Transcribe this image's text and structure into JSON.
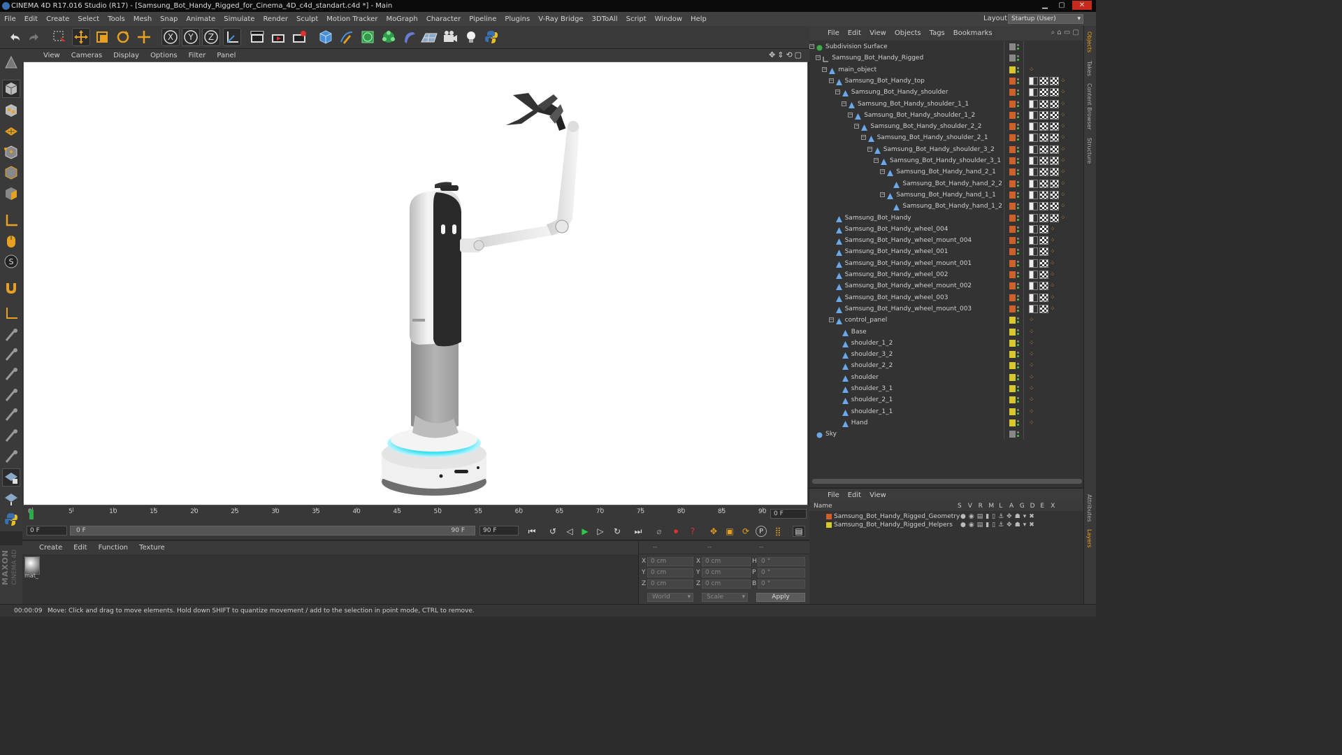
{
  "window": {
    "title": "CINEMA 4D R17.016 Studio (R17) - [Samsung_Bot_Handy_Rigged_for_Cinema_4D_c4d_standart.c4d *] - Main"
  },
  "menubar": [
    "File",
    "Edit",
    "Create",
    "Select",
    "Tools",
    "Mesh",
    "Snap",
    "Animate",
    "Simulate",
    "Render",
    "Sculpt",
    "Motion Tracker",
    "MoGraph",
    "Character",
    "Pipeline",
    "Plugins",
    "V-Ray Bridge",
    "3DToAll",
    "Script",
    "Window",
    "Help"
  ],
  "layout": {
    "label": "Layout:",
    "value": "Startup (User)"
  },
  "viewport_menu": [
    "View",
    "Cameras",
    "Display",
    "Options",
    "Filter",
    "Panel"
  ],
  "object_manager": {
    "menu": [
      "File",
      "Edit",
      "View",
      "Objects",
      "Tags",
      "Bookmarks"
    ],
    "items": [
      {
        "name": "Subdivision Surface",
        "depth": 0,
        "icon": "subdivision-icon",
        "color": "#888888"
      },
      {
        "name": "Samsung_Bot_Handy_Rigged",
        "depth": 1,
        "icon": "null-icon",
        "color": "#888888"
      },
      {
        "name": "main_object",
        "depth": 2,
        "icon": "joint-icon",
        "color": "#d8c82a"
      },
      {
        "name": "Samsung_Bot_Handy_top",
        "depth": 3,
        "icon": "joint-icon",
        "color": "#d0602a"
      },
      {
        "name": "Samsung_Bot_Handy_shoulder",
        "depth": 4,
        "icon": "joint-icon",
        "color": "#d0602a"
      },
      {
        "name": "Samsung_Bot_Handy_shoulder_1_1",
        "depth": 5,
        "icon": "joint-icon",
        "color": "#d0602a"
      },
      {
        "name": "Samsung_Bot_Handy_shoulder_1_2",
        "depth": 6,
        "icon": "joint-icon",
        "color": "#d0602a"
      },
      {
        "name": "Samsung_Bot_Handy_shoulder_2_2",
        "depth": 7,
        "icon": "joint-icon",
        "color": "#d0602a"
      },
      {
        "name": "Samsung_Bot_Handy_shoulder_2_1",
        "depth": 8,
        "icon": "joint-icon",
        "color": "#d0602a"
      },
      {
        "name": "Samsung_Bot_Handy_shoulder_3_2",
        "depth": 9,
        "icon": "joint-icon",
        "color": "#d0602a"
      },
      {
        "name": "Samsung_Bot_Handy_shoulder_3_1",
        "depth": 10,
        "icon": "joint-icon",
        "color": "#d0602a"
      },
      {
        "name": "Samsung_Bot_Handy_hand_2_1",
        "depth": 11,
        "icon": "joint-icon",
        "color": "#d0602a"
      },
      {
        "name": "Samsung_Bot_Handy_hand_2_2",
        "depth": 12,
        "icon": "joint-icon",
        "color": "#d0602a"
      },
      {
        "name": "Samsung_Bot_Handy_hand_1_1",
        "depth": 11,
        "icon": "joint-icon",
        "color": "#d0602a"
      },
      {
        "name": "Samsung_Bot_Handy_hand_1_2",
        "depth": 12,
        "icon": "joint-icon",
        "color": "#d0602a"
      },
      {
        "name": "Samsung_Bot_Handy",
        "depth": 3,
        "icon": "joint-icon",
        "color": "#d0602a"
      },
      {
        "name": "Samsung_Bot_Handy_wheel_004",
        "depth": 3,
        "icon": "joint-icon",
        "color": "#d0602a"
      },
      {
        "name": "Samsung_Bot_Handy_wheel_mount_004",
        "depth": 3,
        "icon": "joint-icon",
        "color": "#d0602a"
      },
      {
        "name": "Samsung_Bot_Handy_wheel_001",
        "depth": 3,
        "icon": "joint-icon",
        "color": "#d0602a"
      },
      {
        "name": "Samsung_Bot_Handy_wheel_mount_001",
        "depth": 3,
        "icon": "joint-icon",
        "color": "#d0602a"
      },
      {
        "name": "Samsung_Bot_Handy_wheel_002",
        "depth": 3,
        "icon": "joint-icon",
        "color": "#d0602a"
      },
      {
        "name": "Samsung_Bot_Handy_wheel_mount_002",
        "depth": 3,
        "icon": "joint-icon",
        "color": "#d0602a"
      },
      {
        "name": "Samsung_Bot_Handy_wheel_003",
        "depth": 3,
        "icon": "joint-icon",
        "color": "#d0602a"
      },
      {
        "name": "Samsung_Bot_Handy_wheel_mount_003",
        "depth": 3,
        "icon": "joint-icon",
        "color": "#d0602a"
      },
      {
        "name": "control_panel",
        "depth": 3,
        "icon": "joint-icon",
        "color": "#d8c82a"
      },
      {
        "name": "Base",
        "depth": 4,
        "icon": "joint-icon",
        "color": "#d8c82a"
      },
      {
        "name": "shoulder_1_2",
        "depth": 4,
        "icon": "joint-icon",
        "color": "#d8c82a"
      },
      {
        "name": "shoulder_3_2",
        "depth": 4,
        "icon": "joint-icon",
        "color": "#d8c82a"
      },
      {
        "name": "shoulder_2_2",
        "depth": 4,
        "icon": "joint-icon",
        "color": "#d8c82a"
      },
      {
        "name": "shoulder",
        "depth": 4,
        "icon": "joint-icon",
        "color": "#d8c82a"
      },
      {
        "name": "shoulder_3_1",
        "depth": 4,
        "icon": "joint-icon",
        "color": "#d8c82a"
      },
      {
        "name": "shoulder_2_1",
        "depth": 4,
        "icon": "joint-icon",
        "color": "#d8c82a"
      },
      {
        "name": "shoulder_1_1",
        "depth": 4,
        "icon": "joint-icon",
        "color": "#d8c82a"
      },
      {
        "name": "Hand",
        "depth": 4,
        "icon": "joint-icon",
        "color": "#d8c82a"
      },
      {
        "name": "Sky",
        "depth": 0,
        "icon": "sky-icon",
        "color": "#888888"
      }
    ]
  },
  "layer_manager": {
    "menu": [
      "File",
      "Edit",
      "View"
    ],
    "columns": [
      "Name",
      "S",
      "V",
      "R",
      "M",
      "L",
      "A",
      "G",
      "D",
      "E",
      "X"
    ],
    "layers": [
      {
        "name": "Samsung_Bot_Handy_Rigged_Geometry",
        "color": "#d0602a"
      },
      {
        "name": "Samsung_Bot_Handy_Rigged_Helpers",
        "color": "#d8c82a"
      }
    ]
  },
  "timeline": {
    "ticks": [
      "0",
      "5",
      "10",
      "15",
      "20",
      "25",
      "30",
      "35",
      "40",
      "45",
      "50",
      "55",
      "60",
      "65",
      "70",
      "75",
      "80",
      "85",
      "90"
    ],
    "current_frame": "0 F",
    "start_field": "0 F",
    "range_start": "0 F",
    "range_end": "90 F",
    "end_field": "90 F"
  },
  "material_manager": {
    "menu": [
      "Create",
      "Edit",
      "Function",
      "Texture"
    ],
    "materials": [
      {
        "name": "mat_"
      }
    ]
  },
  "coordinates": {
    "header": [
      "--",
      "--",
      "--"
    ],
    "rows": [
      {
        "axis": "X",
        "pos": "0 cm",
        "size": "0 cm",
        "rot_label": "H",
        "rot": "0 °"
      },
      {
        "axis": "Y",
        "pos": "0 cm",
        "size": "0 cm",
        "rot_label": "P",
        "rot": "0 °"
      },
      {
        "axis": "Z",
        "pos": "0 cm",
        "size": "0 cm",
        "rot_label": "B",
        "rot": "0 °"
      }
    ],
    "mode": "World",
    "size_mode": "Scale",
    "apply": "Apply"
  },
  "status": {
    "time": "00:00:09",
    "message": "Move: Click and drag to move elements. Hold down SHIFT to quantize movement / add to the selection in point mode, CTRL to remove."
  },
  "right_tabs": [
    "Objects",
    "Takes",
    "Content Browser",
    "Structure",
    "Attributes",
    "Layers"
  ],
  "branding": {
    "maxon": "MAXON",
    "product": "CINEMA 4D"
  },
  "colors": {
    "accent": "#4a90d8",
    "orange": "#d0602a",
    "yellow": "#d8c82a",
    "glow": "#3fe0f0"
  }
}
